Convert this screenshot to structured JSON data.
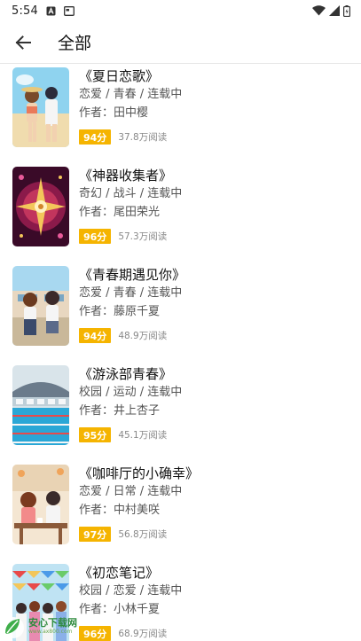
{
  "status_bar": {
    "time": "5:54",
    "left_icons": [
      "a-badge-icon",
      "cast-icon"
    ],
    "right_icons": [
      "wifi-icon",
      "cell-signal-icon",
      "battery-icon"
    ]
  },
  "header": {
    "back_icon": "arrow-back-icon",
    "title": "全部"
  },
  "books": [
    {
      "title": "《夏日恋歌》",
      "tags": "恋爱 / 青春 / 连载中",
      "author": "作者：田中樱",
      "score": "94分",
      "reads": "37.8万阅读",
      "cover": "summer-couple"
    },
    {
      "title": "《神器收集者》",
      "tags": "奇幻 / 战斗 / 连载中",
      "author": "作者：尾田荣光",
      "score": "96分",
      "reads": "57.3万阅读",
      "cover": "fantasy-artifact"
    },
    {
      "title": "《青春期遇见你》",
      "tags": "恋爱 / 青春 / 连载中",
      "author": "作者：藤原千夏",
      "score": "94分",
      "reads": "48.9万阅读",
      "cover": "school-couple"
    },
    {
      "title": "《游泳部青春》",
      "tags": "校园 / 运动 / 连载中",
      "author": "作者：井上杏子",
      "score": "95分",
      "reads": "45.1万阅读",
      "cover": "swimming-pool"
    },
    {
      "title": "《咖啡厅的小确幸》",
      "tags": "恋爱 / 日常 / 连载中",
      "author": "作者：中村美咲",
      "score": "97分",
      "reads": "56.8万阅读",
      "cover": "cafe-couple"
    },
    {
      "title": "《初恋笔记》",
      "tags": "校园 / 恋爱 / 连载中",
      "author": "作者：小林千夏",
      "score": "96分",
      "reads": "68.9万阅读",
      "cover": "festival-crowd"
    }
  ],
  "watermark": {
    "title": "安心下载网",
    "url": "www.ax800.com",
    "logo_icon": "leaf-logo-icon"
  },
  "colors": {
    "score_badge": "#f5b400",
    "divider": "#e6e6e6",
    "watermark_green": "#2e8b3d"
  }
}
